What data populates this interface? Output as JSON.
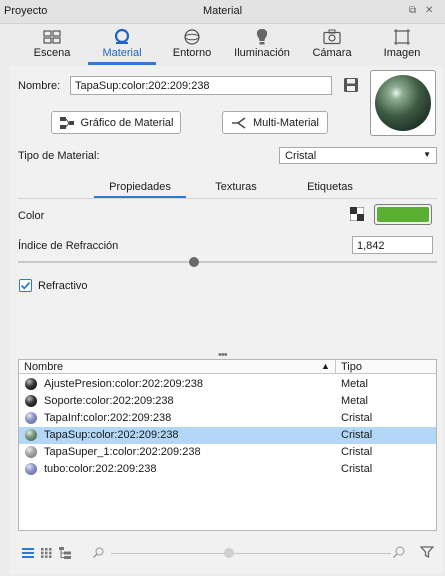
{
  "titlebar": {
    "left_title": "Proyecto",
    "center_title": "Material"
  },
  "tabs": [
    {
      "label": "Escena",
      "icon": "scene-icon"
    },
    {
      "label": "Material",
      "icon": "material-icon",
      "active": true
    },
    {
      "label": "Entorno",
      "icon": "environment-icon"
    },
    {
      "label": "Iluminación",
      "icon": "lightbulb-icon"
    },
    {
      "label": "Cámara",
      "icon": "camera-icon"
    },
    {
      "label": "Imagen",
      "icon": "image-icon"
    }
  ],
  "material": {
    "name_label": "Nombre:",
    "name_value": "TapaSup:color:202:209:238",
    "graph_button": "Gráfico de Material",
    "multi_button": "Multi-Material",
    "type_label": "Tipo de Material:",
    "type_value": "Cristal"
  },
  "subtabs": [
    {
      "label": "Propiedades",
      "active": true
    },
    {
      "label": "Texturas"
    },
    {
      "label": "Etiquetas"
    }
  ],
  "properties": {
    "color_label": "Color",
    "color_swatch": "#5aaf32",
    "refraction_label": "Índice de Refracción",
    "refraction_value": "1,842",
    "refractive_label": "Refractivo",
    "refractive_checked": true
  },
  "list": {
    "col_name": "Nombre",
    "col_type": "Tipo",
    "rows": [
      {
        "name": "AjustePresion:color:202:209:238",
        "type": "Metal",
        "ball": "dark"
      },
      {
        "name": "Soporte:color:202:209:238",
        "type": "Metal",
        "ball": "dark"
      },
      {
        "name": "TapaInf:color:202:209:238",
        "type": "Cristal",
        "ball": "blue"
      },
      {
        "name": "TapaSup:color:202:209:238",
        "type": "Cristal",
        "ball": "green",
        "selected": true
      },
      {
        "name": "TapaSuper_1:color:202:209:238",
        "type": "Cristal",
        "ball": "grey"
      },
      {
        "name": "tubo:color:202:209:238",
        "type": "Cristal",
        "ball": "blue"
      }
    ]
  },
  "colors": {
    "accent": "#2d7ad6",
    "selection": "#b3d7f7"
  }
}
